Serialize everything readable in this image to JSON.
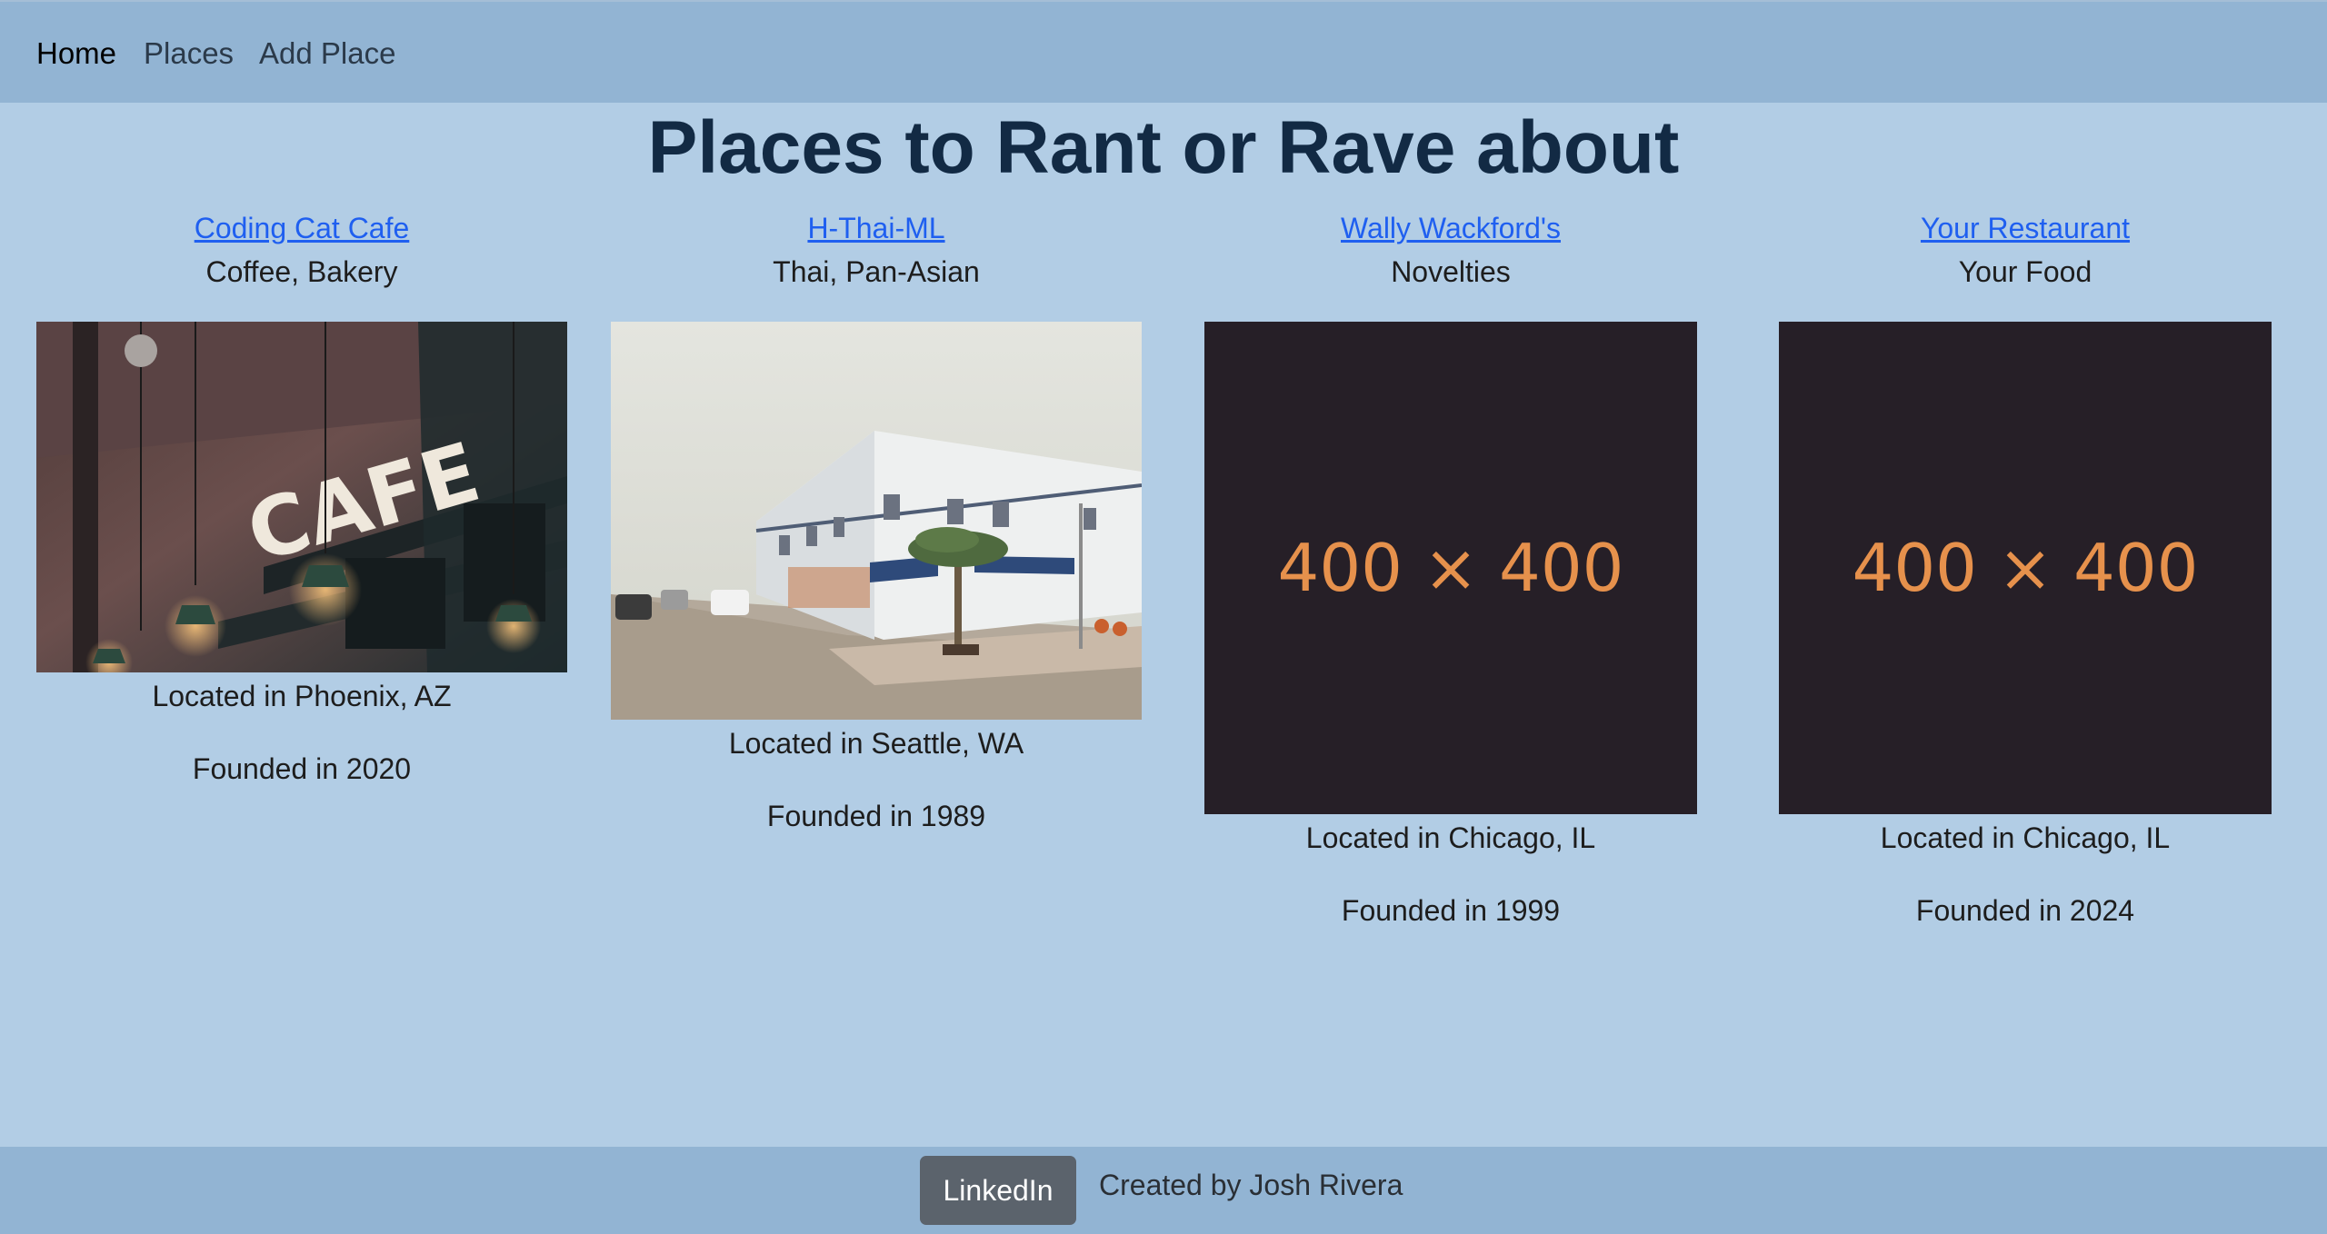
{
  "nav": {
    "home": "Home",
    "places": "Places",
    "add_place": "Add Place"
  },
  "page": {
    "title": "Places to Rant or Rave about"
  },
  "places": [
    {
      "name": "Coding Cat Cafe",
      "cuisines": "Coffee, Bakery",
      "image_sign": "CAFE",
      "location": "Located in Phoenix, AZ",
      "founded": "Founded in 2020"
    },
    {
      "name": "H-Thai-ML",
      "cuisines": "Thai, Pan-Asian",
      "location": "Located in Seattle, WA",
      "founded": "Founded in 1989"
    },
    {
      "name": "Wally Wackford's",
      "cuisines": "Novelties",
      "placeholder_text": "400 × 400",
      "location": "Located in Chicago, IL",
      "founded": "Founded in 1999"
    },
    {
      "name": "Your Restaurant",
      "cuisines": "Your Food",
      "placeholder_text": "400 × 400",
      "location": "Located in Chicago, IL",
      "founded": "Founded in 2024"
    }
  ],
  "footer": {
    "linkedin_label": "LinkedIn",
    "created_by": "Created by Josh Rivera"
  },
  "colors": {
    "page_background": "#b2cde5",
    "navbar_background": "#92b4d3",
    "link": "#1f5ff0",
    "title": "#122a44",
    "placeholder_background": "#261f27",
    "placeholder_text": "#e6914c",
    "button": "#5b636c"
  }
}
